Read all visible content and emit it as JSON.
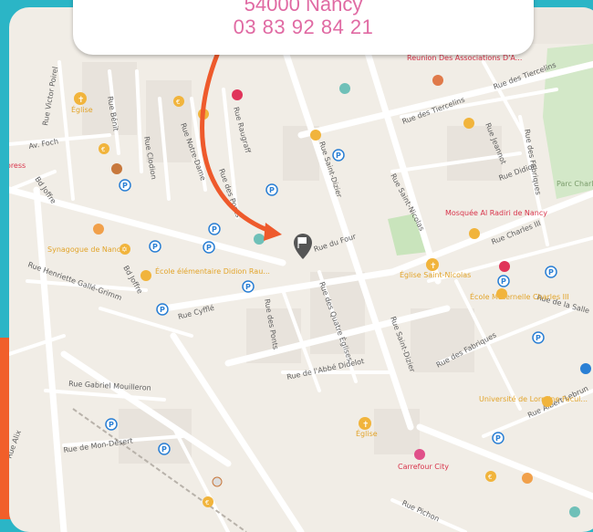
{
  "address_card": {
    "city_line": "54000 Nancy",
    "phone": "03 83 92 84 21",
    "text_color": "#e06aa3"
  },
  "colors": {
    "frame_teal": "#2bb5c6",
    "frame_orange": "#f15f2a",
    "map_background": "#f1ede6",
    "arrow": "#ee5a2c",
    "pin": "#555555"
  },
  "map": {
    "marker_icon": "location-flag-pin-icon",
    "streets": [
      "Rue Victor Poirel",
      "Av. Foch",
      "Bd Joffre",
      "Rue Bénit",
      "Rue Clodion",
      "Rue Notre-Dame",
      "Rue Raugraff",
      "Rue des Ponts",
      "Rue Saint-Dizier",
      "Rue Saint-Nicolas",
      "Rue des Tiercelins",
      "Rue Jeannot",
      "Rue des Fabriques",
      "Rue Didion",
      "Rue Charles III",
      "Rue de la Salle",
      "Rue du Four",
      "Rue des Quatre Églises",
      "Rue Cyfflé",
      "Rue Henriette Gallé-Grimm",
      "Rue Gabriel Mouilleron",
      "Rue de Mon-Désert",
      "Rue de l'Abbé Didelot",
      "Rue Albert Lebrun",
      "Rue Pichon",
      "Rue Alix"
    ],
    "places": {
      "eglise_1": "Église",
      "eglise_2": "Église",
      "synagogue": "Synagogue de Nancy",
      "ecole_didion": "École élémentaire Didion Rau...",
      "reunion_des": "Reunion Des Associations D'A...",
      "mosquee": "Mosquée Al Radiri de Nancy",
      "eglise_saint_nicolas": "Église Saint-Nicolas",
      "ecole_charles": "École Maternelle Charles III",
      "universite": "Université de Lorraine Facul...",
      "carrefour": "Carrefour City",
      "parc": "Parc Charle",
      "express": "xpress"
    }
  }
}
